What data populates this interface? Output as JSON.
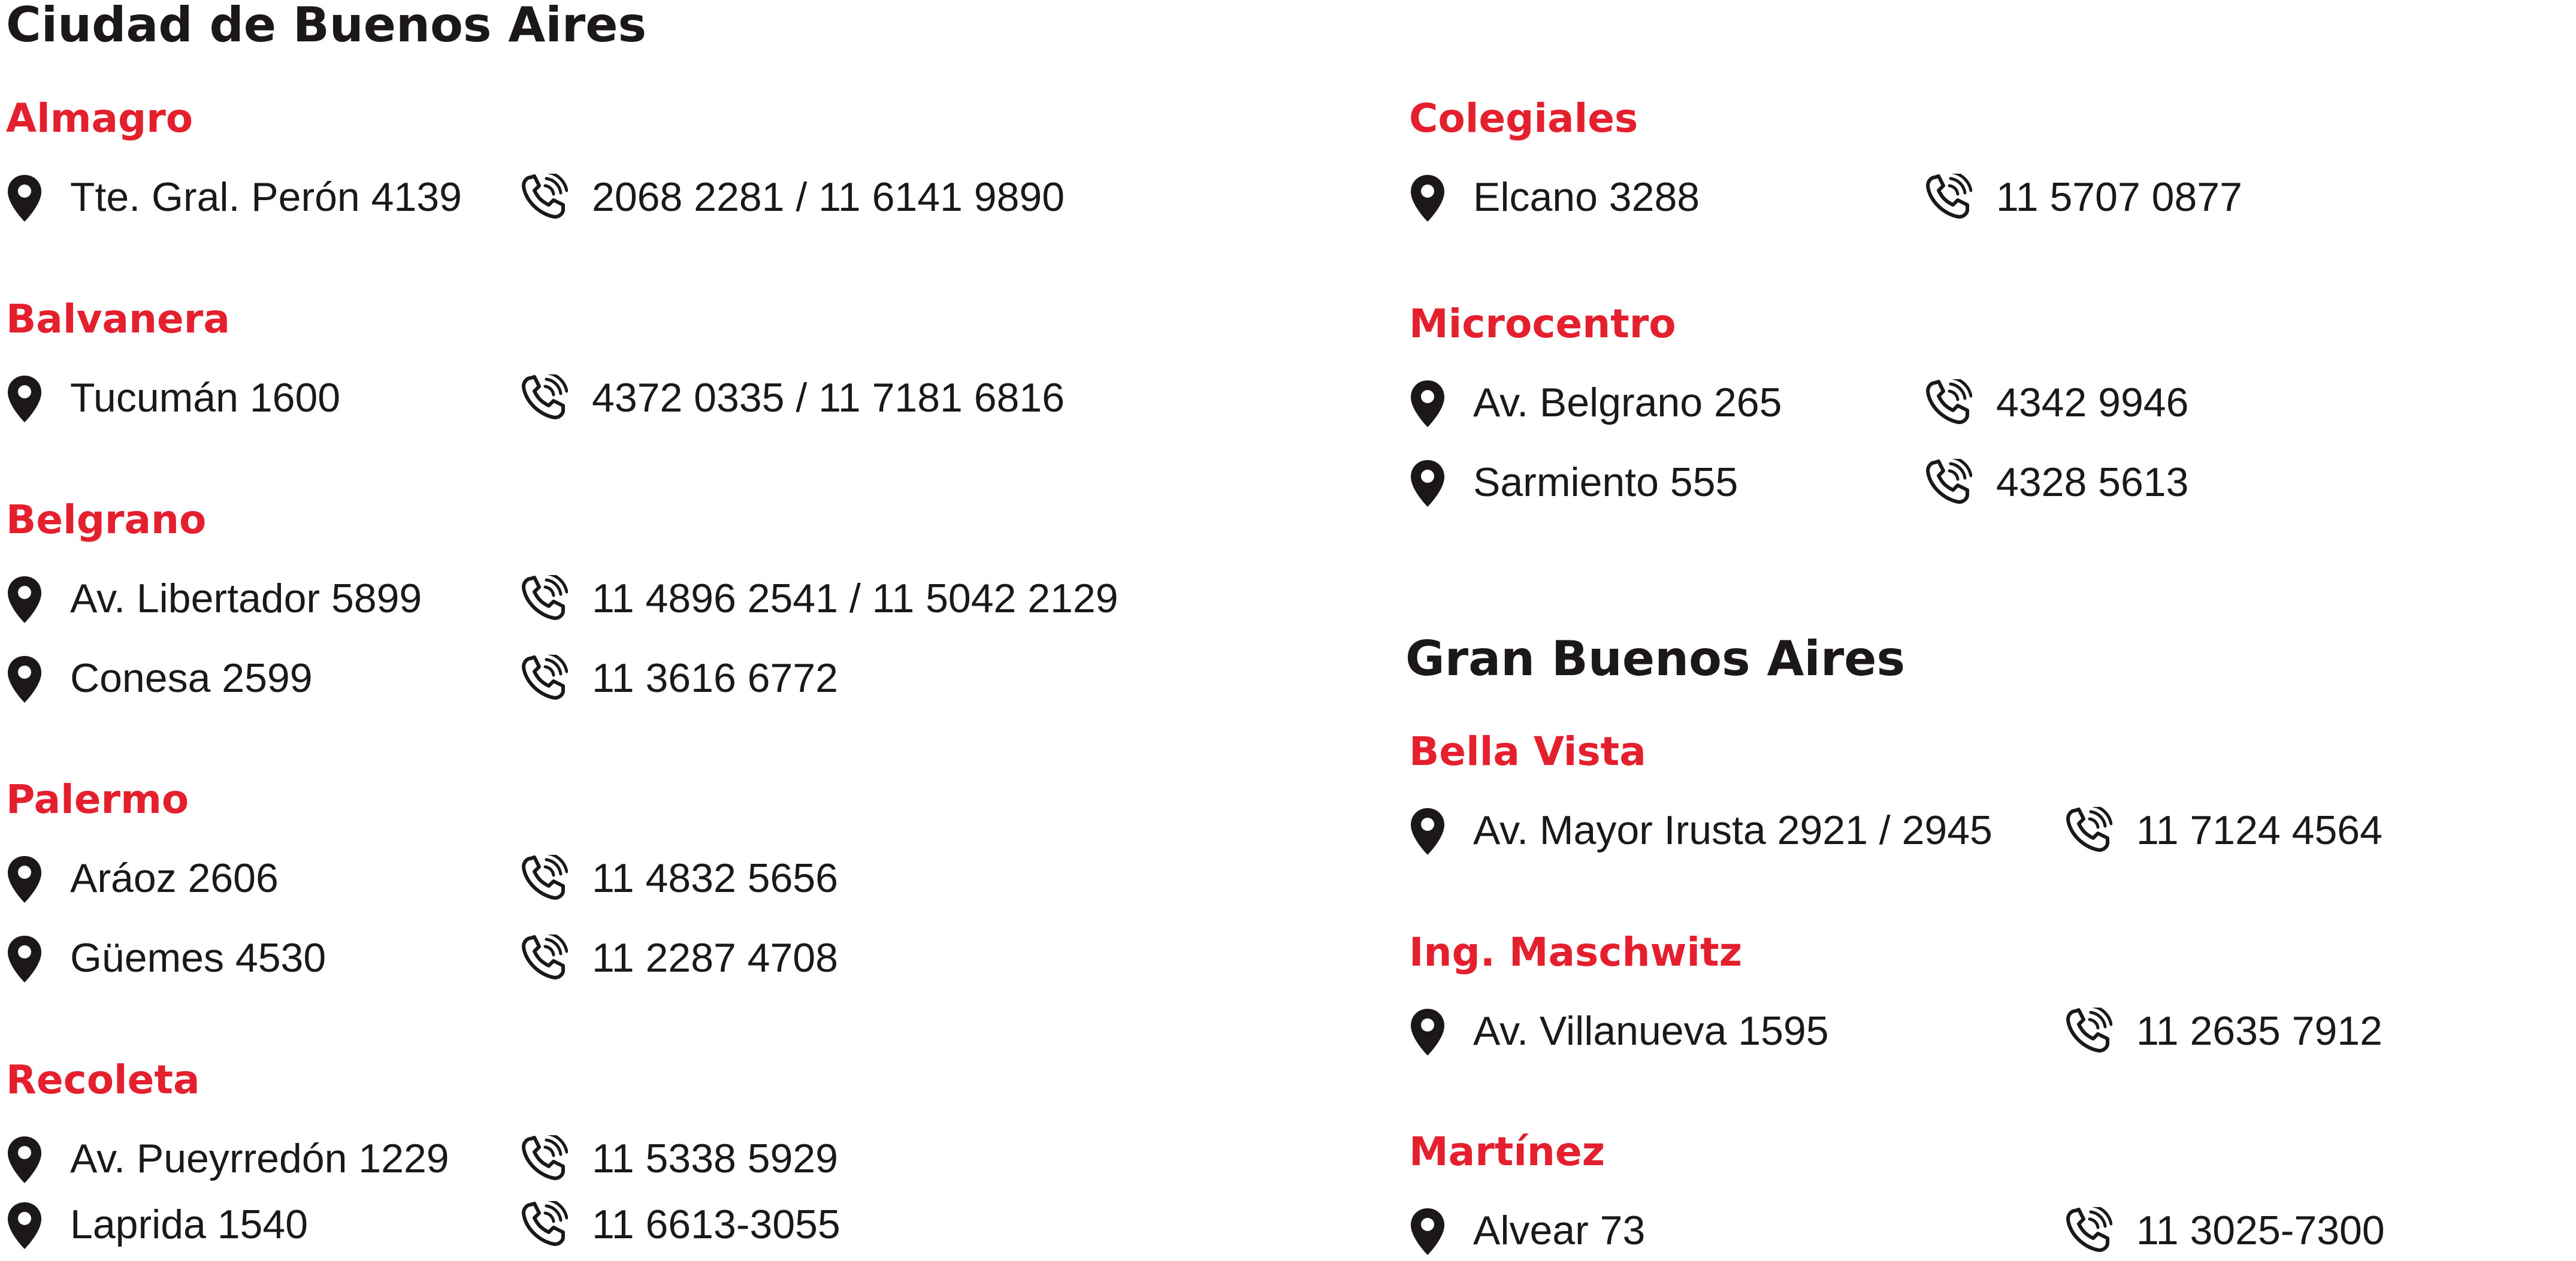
{
  "colors": {
    "accent": "#e4202e",
    "text": "#1c1718",
    "background": "#ffffff"
  },
  "icons": {
    "location": "map-pin-icon",
    "phone": "phone-ringing-icon"
  },
  "caba": {
    "title": "Ciudad de Buenos Aires",
    "branches": [
      {
        "name": "Almagro",
        "locations": [
          {
            "address": "Tte. Gral. Perón 4139",
            "phone": "2068 2281 / 11 6141 9890"
          }
        ]
      },
      {
        "name": "Balvanera",
        "locations": [
          {
            "address": "Tucumán 1600",
            "phone": "4372 0335 / 11 7181 6816"
          }
        ]
      },
      {
        "name": "Belgrano",
        "locations": [
          {
            "address": "Av. Libertador 5899",
            "phone": "11 4896 2541 / 11 5042 2129"
          },
          {
            "address": "Conesa 2599",
            "phone": "11 3616 6772"
          }
        ]
      },
      {
        "name": "Palermo",
        "locations": [
          {
            "address": "Aráoz 2606",
            "phone": "11 4832 5656"
          },
          {
            "address": "Güemes 4530",
            "phone": "11 2287 4708"
          }
        ]
      },
      {
        "name": "Recoleta",
        "locations": [
          {
            "address": "Av. Pueyrredón 1229",
            "phone": "11 5338 5929"
          },
          {
            "address": "Laprida 1540",
            "phone": "11 6613-3055"
          }
        ]
      },
      {
        "name": "Colegiales",
        "locations": [
          {
            "address": "Elcano 3288",
            "phone": "11 5707 0877"
          }
        ]
      },
      {
        "name": "Microcentro",
        "locations": [
          {
            "address": "Av. Belgrano 265",
            "phone": "4342 9946"
          },
          {
            "address": "Sarmiento 555",
            "phone": "4328 5613"
          }
        ]
      }
    ]
  },
  "gba": {
    "title": "Gran Buenos Aires",
    "branches": [
      {
        "name": "Bella Vista",
        "locations": [
          {
            "address": "Av. Mayor Irusta 2921 / 2945",
            "phone": "11 7124 4564"
          }
        ]
      },
      {
        "name": "Ing. Maschwitz",
        "locations": [
          {
            "address": "Av. Villanueva 1595",
            "phone": "11 2635 7912"
          }
        ]
      },
      {
        "name": "Martínez",
        "locations": [
          {
            "address": "Alvear 73",
            "phone": "11 3025-7300"
          }
        ]
      }
    ]
  }
}
